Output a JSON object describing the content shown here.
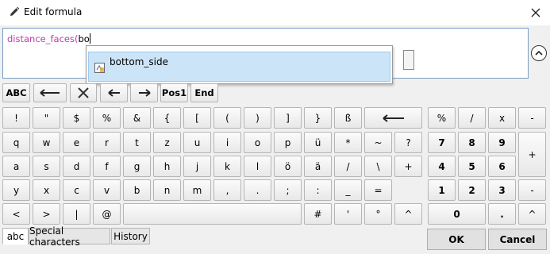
{
  "window": {
    "title": "Edit formula"
  },
  "editor": {
    "function_text": "distance_faces(",
    "typed_text": "bo"
  },
  "autocomplete": {
    "items": [
      {
        "label": "bottom_side"
      }
    ]
  },
  "toolbar": {
    "abc": "ABC",
    "pos1": "Pos1",
    "end": "End"
  },
  "keyboard": {
    "row1_chars": [
      "!",
      "\"",
      "$",
      "%",
      "&",
      "{",
      "[",
      "(",
      ")",
      "]",
      "}",
      "ß"
    ],
    "row1_num": [
      "%",
      "/",
      "x",
      "-"
    ],
    "row2_chars": [
      "q",
      "w",
      "e",
      "r",
      "t",
      "z",
      "u",
      "i",
      "o",
      "p",
      "ü",
      "*",
      "~",
      "?"
    ],
    "row2_num": [
      "7",
      "8",
      "9"
    ],
    "row3_chars": [
      "a",
      "s",
      "d",
      "f",
      "g",
      "h",
      "j",
      "k",
      "l",
      "ö",
      "ä",
      "/",
      "\\",
      "+"
    ],
    "row3_num": [
      "4",
      "5",
      "6"
    ],
    "plus_key": "+",
    "row4_chars": [
      "y",
      "x",
      "c",
      "v",
      "b",
      "n",
      "m",
      ",",
      ".",
      ";",
      ":",
      "_",
      "="
    ],
    "row4_num": [
      "1",
      "2",
      "3"
    ],
    "minus_key": "-",
    "row5_left": [
      "<",
      ">",
      "|",
      "@"
    ],
    "row5_right": [
      "#",
      "'",
      "°",
      "^"
    ],
    "zero_key": "0",
    "dot_key": ".",
    "caret_key": "^"
  },
  "tabs": [
    "abc",
    "Special characters",
    "History"
  ],
  "buttons": {
    "ok": "OK",
    "cancel": "Cancel"
  }
}
